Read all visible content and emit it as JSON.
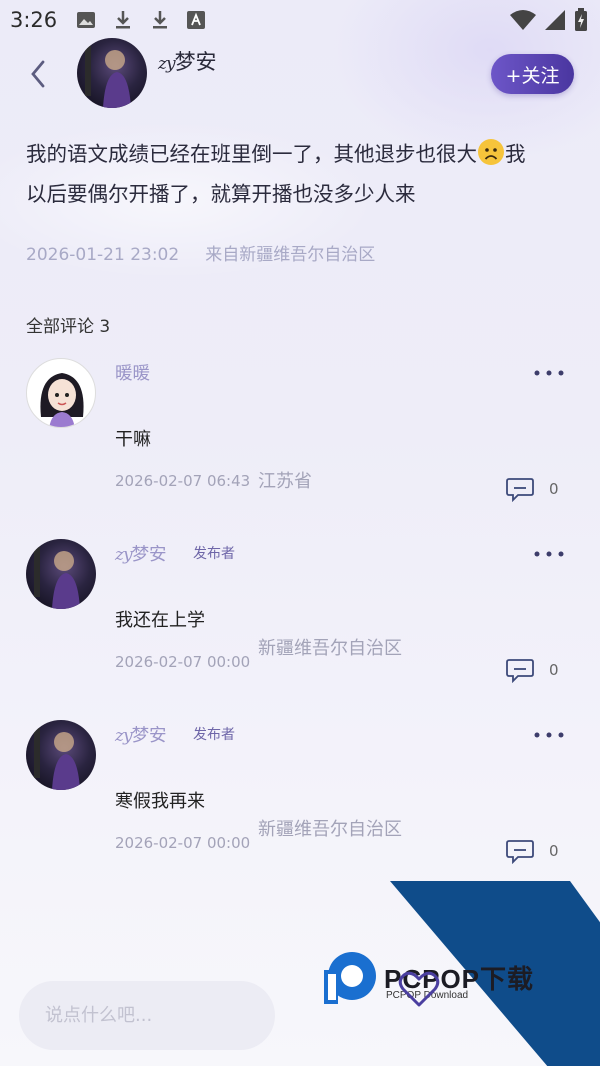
{
  "status_bar": {
    "time": "3:26",
    "icons": [
      "image-icon",
      "download-icon",
      "download-icon",
      "font-icon"
    ],
    "right_icons": [
      "wifi-icon",
      "signal-icon",
      "battery-icon"
    ]
  },
  "header": {
    "author_prefix": "zy",
    "author_name": "梦安",
    "follow_label": "+关注"
  },
  "post": {
    "text_before_emoji": "我的语文成绩已经在班里倒一了，其他退步也很大",
    "emoji": "frowning-face",
    "text_after_emoji_line1": "我",
    "text_line2": "以后要偶尔开播了，就算开播也没多少人来",
    "date": "2026-01-21 23:02",
    "location": "来自新疆维吾尔自治区"
  },
  "comments_header": "全部评论 3",
  "comments": [
    {
      "name_prefix": "",
      "name": "暖暖",
      "badge": "",
      "text": "干嘛",
      "date": "2026-02-07 06:43",
      "location": "江苏省",
      "reply_count": "0"
    },
    {
      "name_prefix": "zy",
      "name": "梦安",
      "badge": "发布者",
      "text": "我还在上学",
      "date": "2026-02-07 00:00",
      "location": "新疆维吾尔自治区",
      "reply_count": "0"
    },
    {
      "name_prefix": "zy",
      "name": "梦安",
      "badge": "发布者",
      "text": "寒假我再来",
      "date": "2026-02-07 00:00",
      "location": "新疆维吾尔自治区",
      "reply_count": "0"
    }
  ],
  "watermark": {
    "brand": "PCPOP下载",
    "sub": "PCPOP Download"
  },
  "bottom_bar": {
    "input_placeholder": "说点什么吧..."
  },
  "colors": {
    "accent": "#5a44b4",
    "meta_text": "#a8a9c6",
    "name_text": "#9a95c8",
    "watermark_band": "#0f4c8a"
  }
}
